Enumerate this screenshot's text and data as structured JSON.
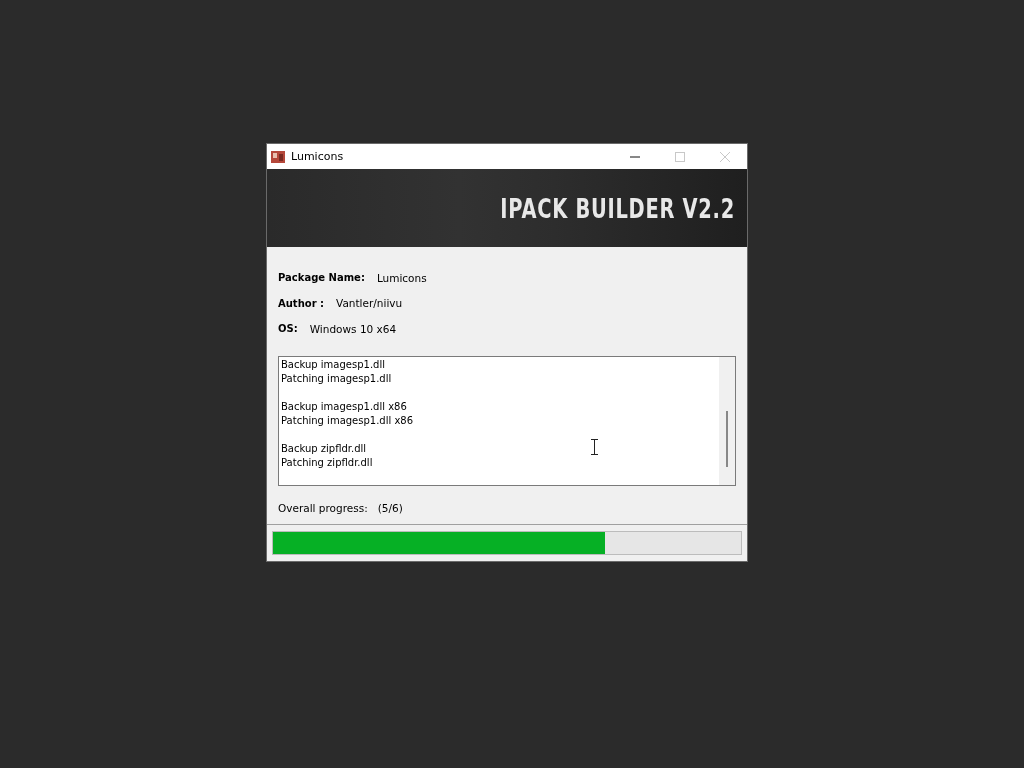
{
  "window": {
    "title": "Lumicons",
    "controls": [
      {
        "kind": "minimize",
        "disabled": false
      },
      {
        "kind": "maximize",
        "disabled": true
      },
      {
        "kind": "close",
        "disabled": true
      }
    ]
  },
  "banner": {
    "title": "IPACK BUILDER V2.2"
  },
  "info": [
    {
      "label": "Package Name:",
      "value": "Lumicons"
    },
    {
      "label": "Author :",
      "value": "Vantler/niivu"
    },
    {
      "label": "OS:",
      "value": "Windows 10 x64"
    }
  ],
  "log": [
    [
      "Backup imagesp1.dll",
      "Patching imagesp1.dll"
    ],
    [
      "Backup imagesp1.dll x86",
      "Patching imagesp1.dll x86"
    ],
    [
      "Backup zipfldr.dll",
      "Patching zipfldr.dll"
    ]
  ],
  "progress": {
    "label": "Overall progress:",
    "count": "(5/6)",
    "level": 0.71
  }
}
